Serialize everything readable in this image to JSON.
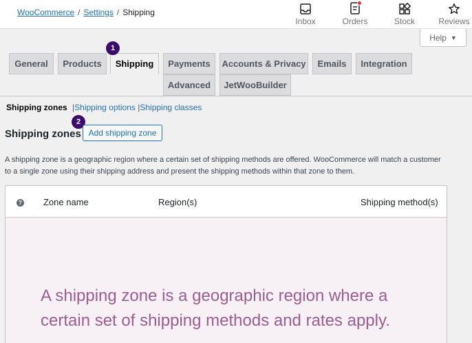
{
  "breadcrumb": {
    "woocommerce": "WooCommerce",
    "settings": "Settings",
    "current": "Shipping",
    "separator": "/"
  },
  "activity": [
    {
      "label": "Inbox",
      "icon": "inbox-icon"
    },
    {
      "label": "Orders",
      "icon": "orders-icon"
    },
    {
      "label": "Stock",
      "icon": "stock-icon"
    },
    {
      "label": "Reviews",
      "icon": "star-icon"
    }
  ],
  "help": {
    "label": "Help",
    "arrow": "▼"
  },
  "tabs": [
    {
      "label": "General"
    },
    {
      "label": "Products"
    },
    {
      "label": "Shipping",
      "active": true
    },
    {
      "label": "Payments"
    },
    {
      "label": "Accounts & Privacy"
    },
    {
      "label": "Emails"
    },
    {
      "label": "Integration"
    },
    {
      "label": "Advanced"
    },
    {
      "label": "JetWooBuilder"
    }
  ],
  "badges": [
    "1",
    "2"
  ],
  "subnav": {
    "current": "Shipping zones",
    "options": "Shipping options",
    "classes": "Shipping classes",
    "pipe": "|"
  },
  "section": {
    "title": "Shipping zones",
    "add_button": "Add shipping zone",
    "description": "A shipping zone is a geographic region where a certain set of shipping methods are offered. WooCommerce will match a customer to a single zone using their shipping address and present the shipping methods within that zone to them."
  },
  "table": {
    "help_mark": "?",
    "headers": [
      "Zone name",
      "Region(s)",
      "Shipping method(s)"
    ],
    "blank_message": "A shipping zone is a geographic region where a certain set of shipping methods and rates apply."
  },
  "colors": {
    "accent": "#2271b1",
    "badge": "#3c096c",
    "blank_text": "#9c5d90",
    "notification": "#d63638"
  }
}
